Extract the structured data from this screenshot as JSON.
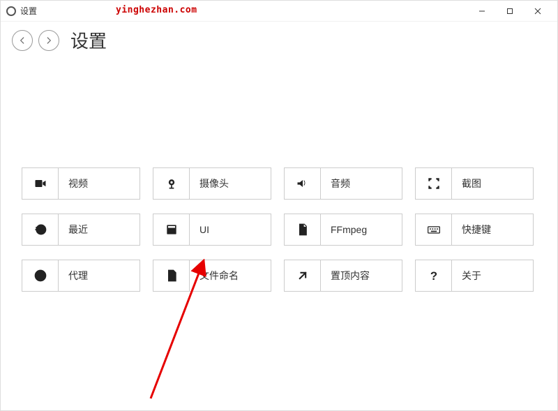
{
  "window": {
    "title": "设置"
  },
  "watermark": "yinghezhan.com",
  "nav": {
    "page_title": "设置"
  },
  "tiles": [
    {
      "id": "video",
      "label": "视频"
    },
    {
      "id": "camera",
      "label": "摄像头"
    },
    {
      "id": "audio",
      "label": "音频"
    },
    {
      "id": "capture",
      "label": "截图"
    },
    {
      "id": "recent",
      "label": "最近"
    },
    {
      "id": "ui",
      "label": "UI"
    },
    {
      "id": "ffmpeg",
      "label": "FFmpeg"
    },
    {
      "id": "hotkeys",
      "label": "快捷键"
    },
    {
      "id": "proxy",
      "label": "代理"
    },
    {
      "id": "filename",
      "label": "文件命名"
    },
    {
      "id": "pin",
      "label": "置顶内容"
    },
    {
      "id": "about",
      "label": "关于"
    }
  ]
}
